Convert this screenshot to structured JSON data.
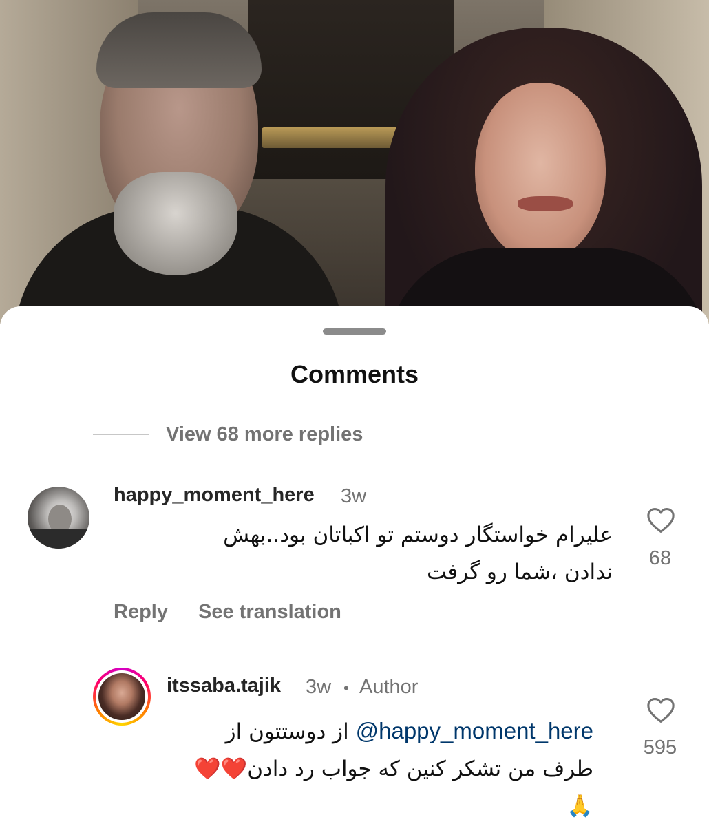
{
  "sheet": {
    "title": "Comments",
    "view_more": "View 68 more replies"
  },
  "comments": [
    {
      "username": "happy_moment_here",
      "time": "3w",
      "text_line1": "علیرام خواستگار دوستم تو اکباتان بود..بهش",
      "text_line2": "ندادن ،شما رو گرفت",
      "like_icon": "heart-outline-icon",
      "likes": "68",
      "reply_label": "Reply",
      "translate_label": "See translation"
    },
    {
      "username": "itssaba.tajik",
      "time": "3w",
      "separator": "•",
      "badge": "Author",
      "mention": "@happy_moment_here",
      "text_line1_after_mention": "از دوستتون از",
      "text_line2": "طرف من تشکر کنین که جواب رد دادن",
      "hearts": "❤️❤️",
      "emoji_line3": "🙏",
      "like_icon": "heart-outline-icon",
      "likes": "595"
    }
  ],
  "colors": {
    "muted": "#737373",
    "mention": "#00376b",
    "heart": "#e0123b"
  }
}
